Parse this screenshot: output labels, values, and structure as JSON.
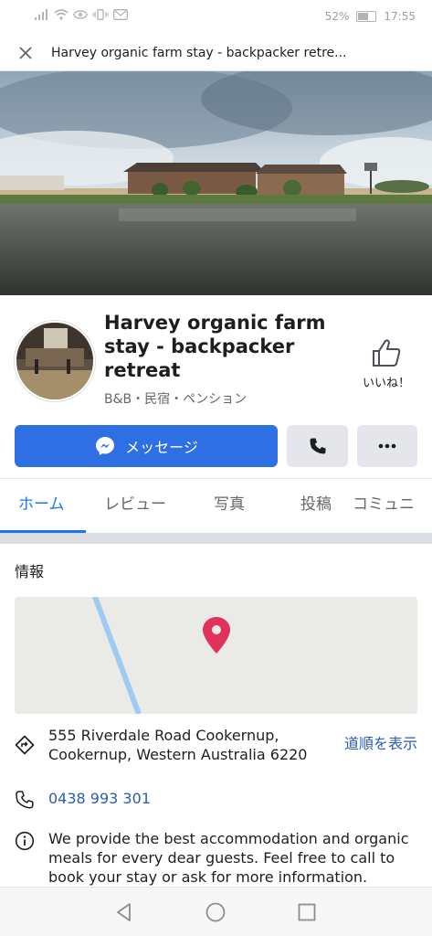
{
  "status_bar": {
    "battery": "52%",
    "time": "17:55"
  },
  "title_bar": {
    "title": "Harvey organic farm stay - backpacker retre..."
  },
  "profile": {
    "name": "Harvey organic farm stay - backpacker retreat",
    "category": "B&B・民宿・ペンション",
    "like_label": "いいね！"
  },
  "actions": {
    "message_label": "メッセージ"
  },
  "tabs": [
    {
      "label": "ホーム"
    },
    {
      "label": "レビュー"
    },
    {
      "label": "写真"
    },
    {
      "label": "投稿"
    },
    {
      "label": "コミュニ"
    }
  ],
  "info": {
    "section_title": "情報",
    "address_line1": "555 Riverdale Road   Cookernup,",
    "address_line2": "Cookernup, Western Australia 6220",
    "directions_label": "道順を表示",
    "phone": "0438 993 301",
    "description_line1": "We provide the best accommodation and organic",
    "description_line2": "meals for every dear guests. Feel free to call to",
    "description_line3": "book your stay or ask for more information."
  },
  "colors": {
    "primary": "#2f6fe4",
    "link": "#2a5db0",
    "map_pin": "#e0325a",
    "map_road": "#9fcbf3"
  }
}
